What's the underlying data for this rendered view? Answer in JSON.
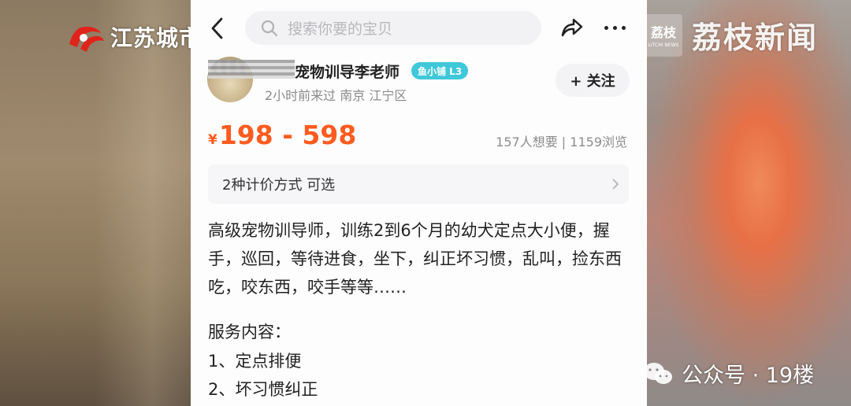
{
  "overlay": {
    "station_logo": "江苏城市",
    "watermark_badge": "荔枝",
    "watermark_badge_sub": "LITCHI NEWS",
    "watermark_text": "荔枝新闻",
    "credit": "公众号 · 19楼"
  },
  "topbar": {
    "search_placeholder": "搜索你要的宝贝"
  },
  "seller": {
    "name": "宠物训导李老师",
    "badge": "鱼小铺 L3",
    "last_seen": "2小时前来过",
    "location": "南京 江宁区",
    "follow_label": "+ 关注"
  },
  "listing": {
    "currency": "¥",
    "price_range": "198 - 598",
    "stats": "157人想要 | 1159浏览",
    "pricing_options": "2种计价方式 可选",
    "description": "高级宠物训导师，训练2到6个月的幼犬定点大小便，握手，巡回，等待进食，坐下，纠正坏习惯，乱叫，捡东西吃，咬东西，咬手等等……",
    "services_title": "服务内容：",
    "services": [
      "1、定点排便",
      "2、坏习惯纠正"
    ]
  },
  "colors": {
    "price": "#ff5b1f",
    "badge": "#3fc8d9",
    "station_red": "#e0231b"
  }
}
